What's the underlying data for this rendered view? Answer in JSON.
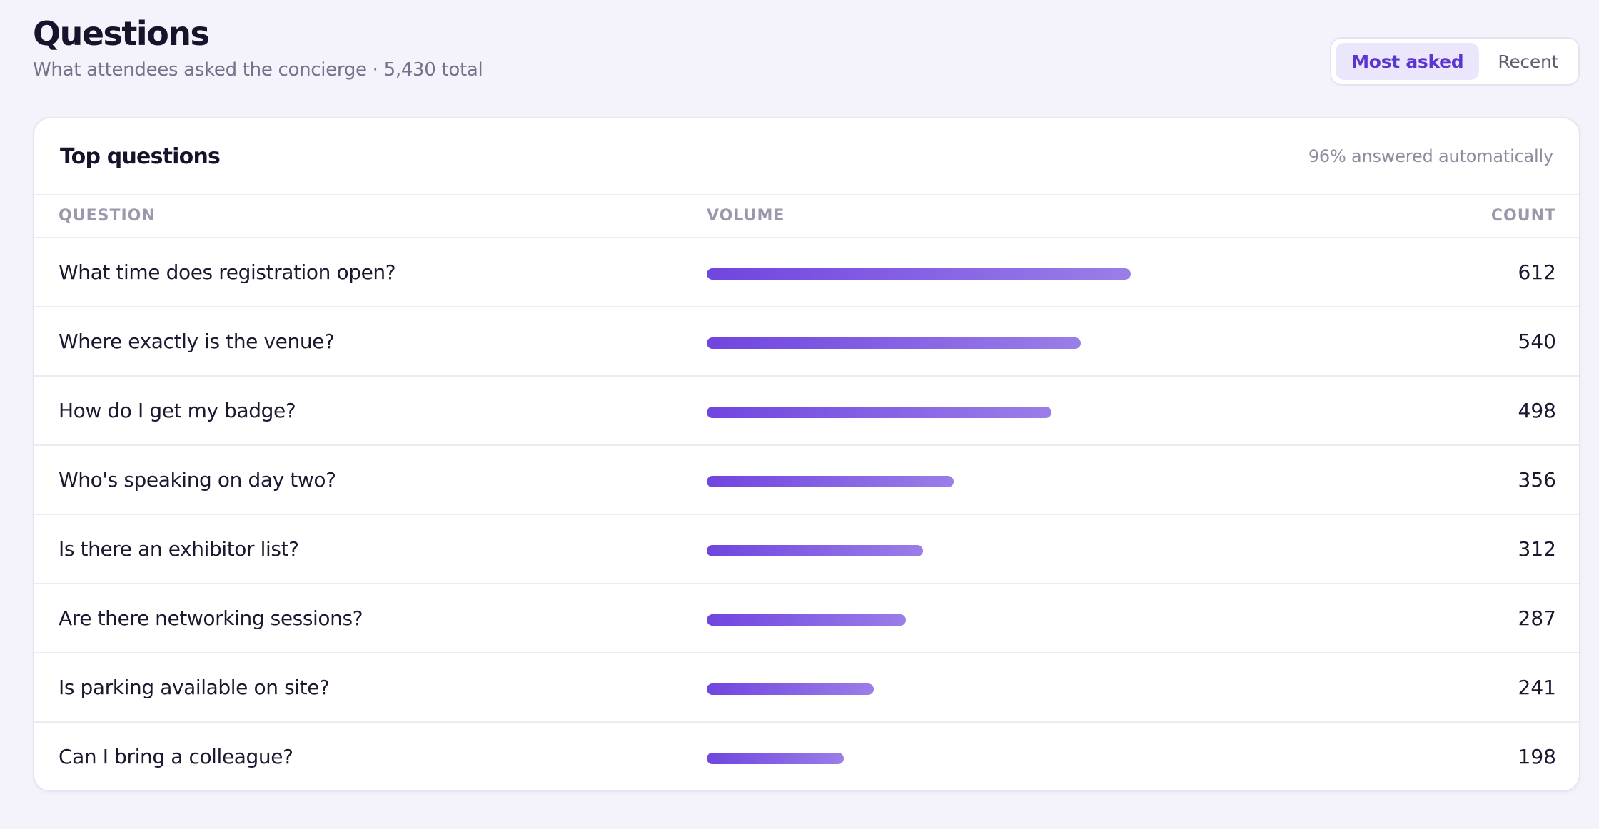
{
  "header": {
    "title": "Questions",
    "subtitle": "What attendees asked the concierge · 5,430 total"
  },
  "view_toggle": {
    "options": [
      "Most asked",
      "Recent"
    ],
    "selected": "Most asked"
  },
  "card": {
    "title": "Top questions",
    "meta": "96% answered automatically"
  },
  "table": {
    "columns": [
      "QUESTION",
      "VOLUME",
      "COUNT"
    ],
    "max_count": 612,
    "rows": [
      {
        "question": "What time does registration open?",
        "count": "612"
      },
      {
        "question": "Where exactly is the venue?",
        "count": "540"
      },
      {
        "question": "How do I get my badge?",
        "count": "498"
      },
      {
        "question": "Who's speaking on day two?",
        "count": "356"
      },
      {
        "question": "Is there an exhibitor list?",
        "count": "312"
      },
      {
        "question": "Are there networking sessions?",
        "count": "287"
      },
      {
        "question": "Is parking available on site?",
        "count": "241"
      },
      {
        "question": "Can I bring a colleague?",
        "count": "198"
      }
    ]
  },
  "colors": {
    "accent": "#6b44dc",
    "bar_start": "#7045e0",
    "bar_end": "#9a7ee8",
    "background": "#f4f3fc"
  }
}
